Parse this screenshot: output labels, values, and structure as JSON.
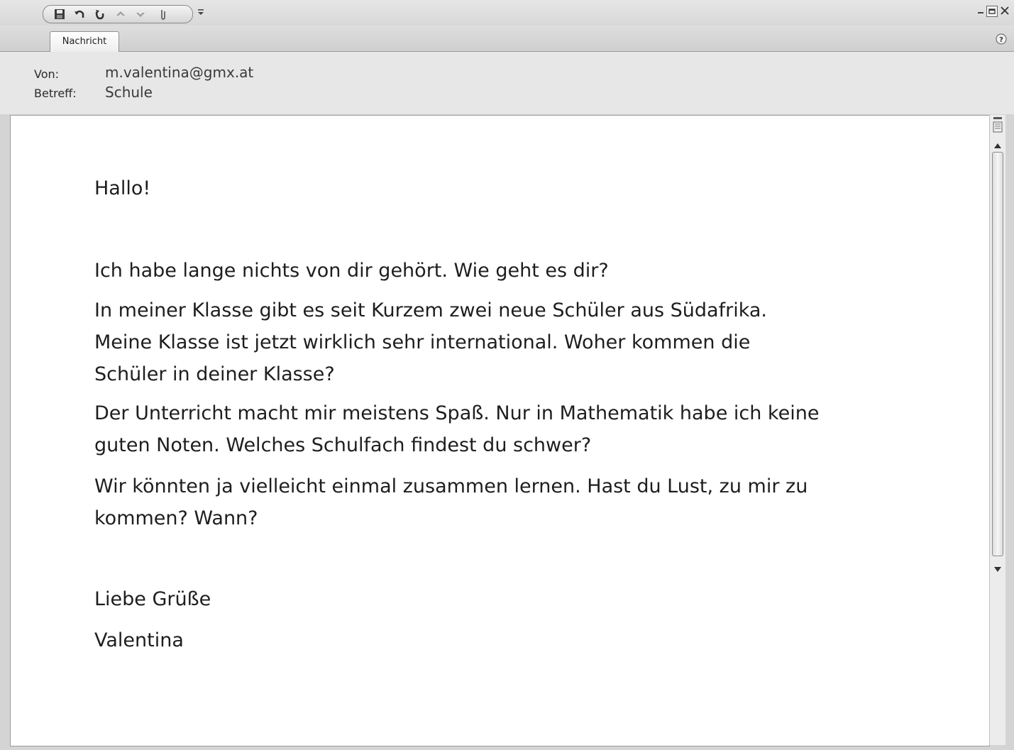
{
  "ribbon": {
    "tabs": [
      {
        "label": "Nachricht"
      }
    ]
  },
  "icons": {
    "qat": [
      "save-icon",
      "undo-icon",
      "redo-icon",
      "previous-item-icon",
      "next-item-icon",
      "attach-icon",
      "qat-customize-icon"
    ],
    "window": [
      "minimize-icon",
      "restore-icon",
      "close-icon"
    ],
    "help": "help-icon"
  },
  "header": {
    "from_label": "Von:",
    "from_value": "m.valentina@gmx.at",
    "subject_label": "Betreff:",
    "subject_value": "Schule"
  },
  "message": {
    "greeting": "Hallo!",
    "paragraphs": [
      "Ich habe lange nichts von dir gehört. Wie geht es dir?",
      "In meiner Klasse gibt es seit Kurzem zwei neue Schüler aus Südafrika.\nMeine Klasse ist jetzt wirklich sehr international. Woher kommen die\nSchüler in deiner Klasse?",
      "Der Unterricht macht mir meistens Spaß. Nur in Mathematik habe ich keine\nguten Noten. Welches Schulfach findest du schwer?",
      "Wir könnten ja vielleicht einmal zusammen lernen. Hast du Lust, zu mir zu\nkommen? Wann?"
    ],
    "closing": "Liebe Grüße",
    "signature": "Valentina"
  }
}
